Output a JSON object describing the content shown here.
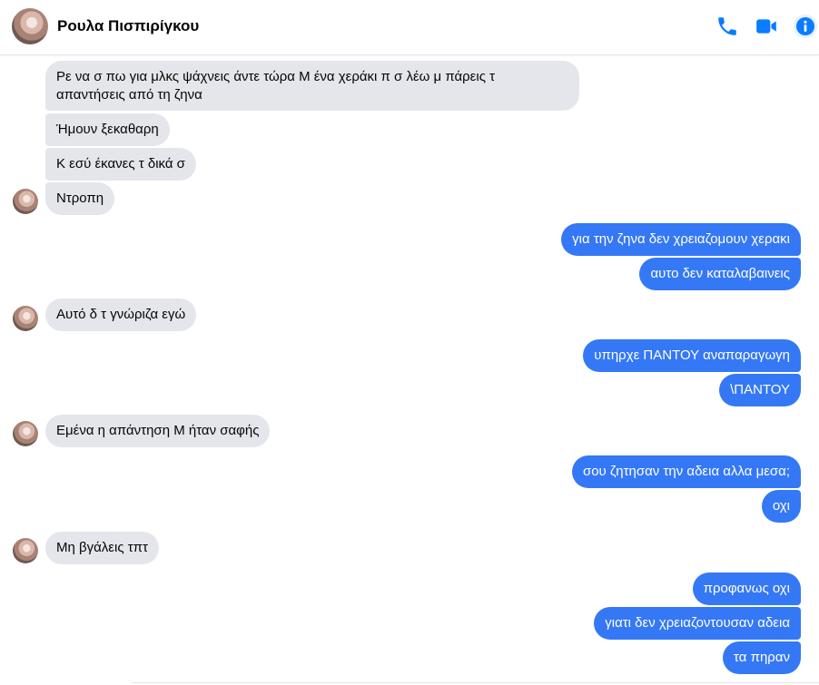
{
  "header": {
    "contact_name": "Ρουλα Πισπιρίγκου",
    "icons": [
      "phone-icon",
      "video-camera-icon",
      "info-icon"
    ],
    "accent_color": "#0a7cff"
  },
  "messages": [
    {
      "from": "contact",
      "text_lines": [
        "Ρε να σ πω για μλκς ψάχνεις άντε τώρα Μ ένα χεράκι π σ λέω μ πάρεις τ",
        "απαντήσεις από τη ζηνα"
      ]
    },
    {
      "from": "contact",
      "text": "Ήμουν ξεκαθαρη"
    },
    {
      "from": "contact",
      "text": "Κ εσύ έκανες τ δικά σ"
    },
    {
      "from": "contact",
      "text": "Ντροπη"
    },
    {
      "from": "me",
      "text": "για την ζηνα δεν χρειαζομουν χερακι"
    },
    {
      "from": "me",
      "text": "αυτο δεν καταλαβαινεις"
    },
    {
      "from": "contact",
      "text": "Αυτό δ τ γνώριζα εγώ"
    },
    {
      "from": "me",
      "text": "υπηρχε ΠΑΝΤΟΥ αναπαραγωγη"
    },
    {
      "from": "me",
      "text": "\\ΠΑΝΤΟΥ"
    },
    {
      "from": "contact",
      "text": "Εμένα η απάντηση Μ ήταν σαφής"
    },
    {
      "from": "me",
      "text": "σου ζητησαν την αδεια αλλα μεσα;"
    },
    {
      "from": "me",
      "text": "οχι"
    },
    {
      "from": "contact",
      "text": "Μη βγάλεις τπτ"
    },
    {
      "from": "me",
      "text": "προφανως οχι"
    },
    {
      "from": "me",
      "text": "γιατι δεν χρειαζοντουσαν αδεια"
    },
    {
      "from": "me",
      "text": "τα πηραν"
    }
  ],
  "colors": {
    "incoming_bubble": "#e4e6eb",
    "outgoing_bubble": "#3578f6"
  }
}
